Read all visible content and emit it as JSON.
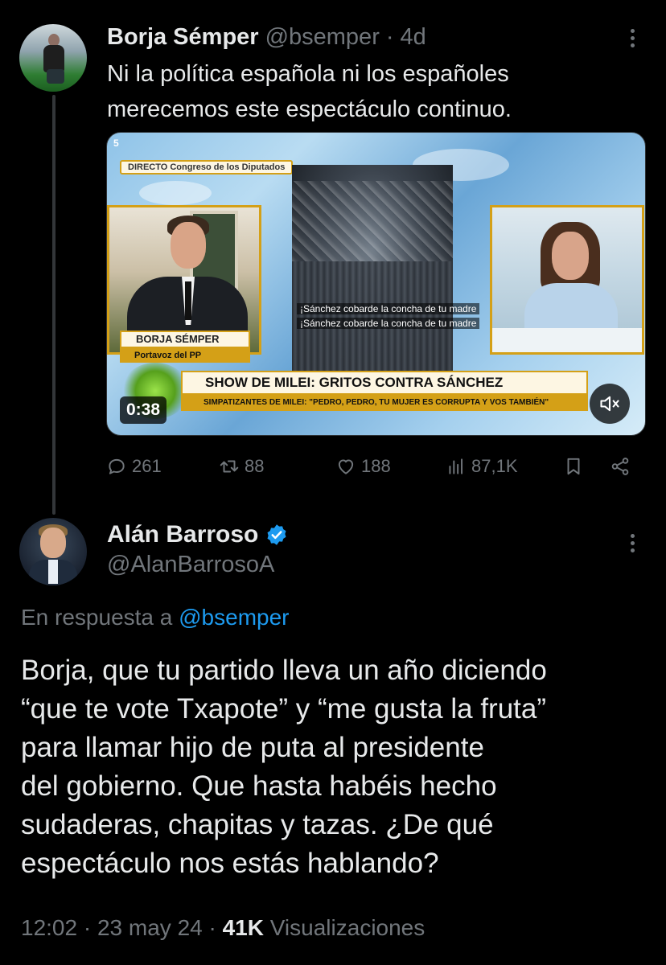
{
  "tweet1": {
    "author_name": "Borja Sémper",
    "handle": "@bsemper",
    "separator": "·",
    "time": "4d",
    "text_lines": [
      "Ni la política española ni los españoles",
      "merecemos este espectáculo continuo."
    ],
    "video": {
      "duration": "0:38",
      "channel": "5",
      "live_tag": "DIRECTO Congreso de los Diputados",
      "left_name": "BORJA SÉMPER",
      "left_role": "Portavoz del PP",
      "subtitle_lines": [
        "¡Sánchez cobarde la concha de tu madre",
        "¡Sánchez cobarde la concha de tu madre"
      ],
      "banner": "SHOW DE MILEI: GRITOS CONTRA SÁNCHEZ",
      "banner_sub": "SIMPATIZANTES DE MILEI: \"PEDRO, PEDRO, TU MUJER ES CORRUPTA Y VOS TAMBIÉN\"",
      "mute_icon": "speaker-muted-icon"
    },
    "stats": {
      "replies": "261",
      "retweets": "88",
      "likes": "188",
      "views": "87,1K"
    }
  },
  "tweet2": {
    "author_name": "Alán Barroso",
    "verified": true,
    "handle": "@AlanBarrosoA",
    "reply_prefix": "En respuesta a",
    "reply_mention": "@bsemper",
    "body_lines": [
      "Borja, que tu partido lleva un año diciendo",
      "“que te vote Txapote” y “me gusta la fruta”",
      "para llamar hijo de puta al presidente",
      "del gobierno. Que hasta habéis hecho",
      "sudaderas, chapitas y tazas. ¿De qué",
      "espectáculo nos estás hablando?"
    ],
    "time": "12:02",
    "date": "23 may 24",
    "views": "41K",
    "views_label": "Visualizaciones",
    "separator": "·"
  },
  "colors": {
    "background": "#000000",
    "text": "#e7e9ea",
    "muted": "#71767b",
    "accent": "#1d9bf0",
    "tv_gold": "#d4a017"
  }
}
